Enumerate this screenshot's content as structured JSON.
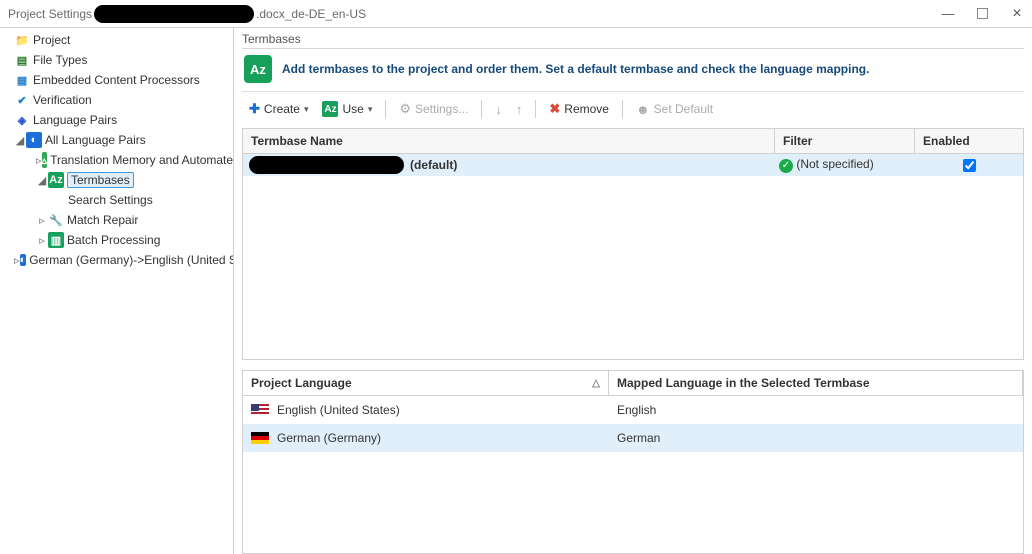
{
  "title": {
    "prefix": "Project Settings",
    "suffix": ".docx_de-DE_en-US"
  },
  "sidebar": {
    "project": "Project",
    "filetypes": "File Types",
    "embed": "Embedded Content Processors",
    "verify": "Verification",
    "langpairs": "Language Pairs",
    "allpairs": "All Language Pairs",
    "tm": "Translation Memory and Automate",
    "tb": "Termbases",
    "search": "Search Settings",
    "match": "Match Repair",
    "batch": "Batch Processing",
    "target": "German (Germany)->English (United S"
  },
  "content": {
    "section": "Termbases",
    "intro": "Add termbases to the project and order them. Set a default termbase and check the language mapping."
  },
  "toolbar": {
    "create": "Create",
    "use": "Use",
    "settings": "Settings...",
    "remove": "Remove",
    "setdefault": "Set Default"
  },
  "table": {
    "h_name": "Termbase Name",
    "h_filter": "Filter",
    "h_enabled": "Enabled",
    "row0_suffix": "(default)",
    "row0_filter": "(Not specified)"
  },
  "table2": {
    "h_pl": "Project Language",
    "h_ml": "Mapped Language in the Selected Termbase",
    "r0_pl": "English (United States)",
    "r0_ml": "English",
    "r1_pl": "German (Germany)",
    "r1_ml": "German"
  }
}
